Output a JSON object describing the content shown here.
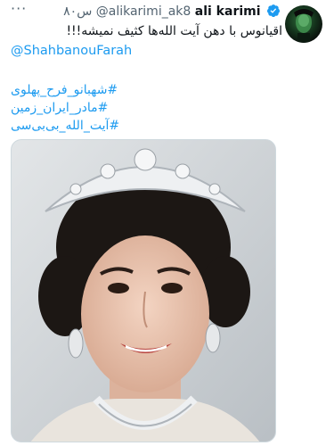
{
  "tweet": {
    "more_label": "···",
    "time": "۸۰س",
    "handle": "@alikarimi_ak8",
    "display_name": "ali karimi",
    "verified_icon": "verified-badge-icon",
    "text": "اقیانوس با دهن آیت الله‌ها کثیف نمیشه!!!",
    "mention": "@ShahbanouFarah",
    "hashtags": [
      "#شهبانو_فرح_پهلوی",
      "#مادر_ایران_زمین",
      "#آیت_الله_بی‌بی‌سی"
    ],
    "media_alt_icon": "portrait-photo",
    "colors": {
      "link": "#1d9bf0",
      "muted": "#536471",
      "verified": "#1d9bf0"
    }
  }
}
